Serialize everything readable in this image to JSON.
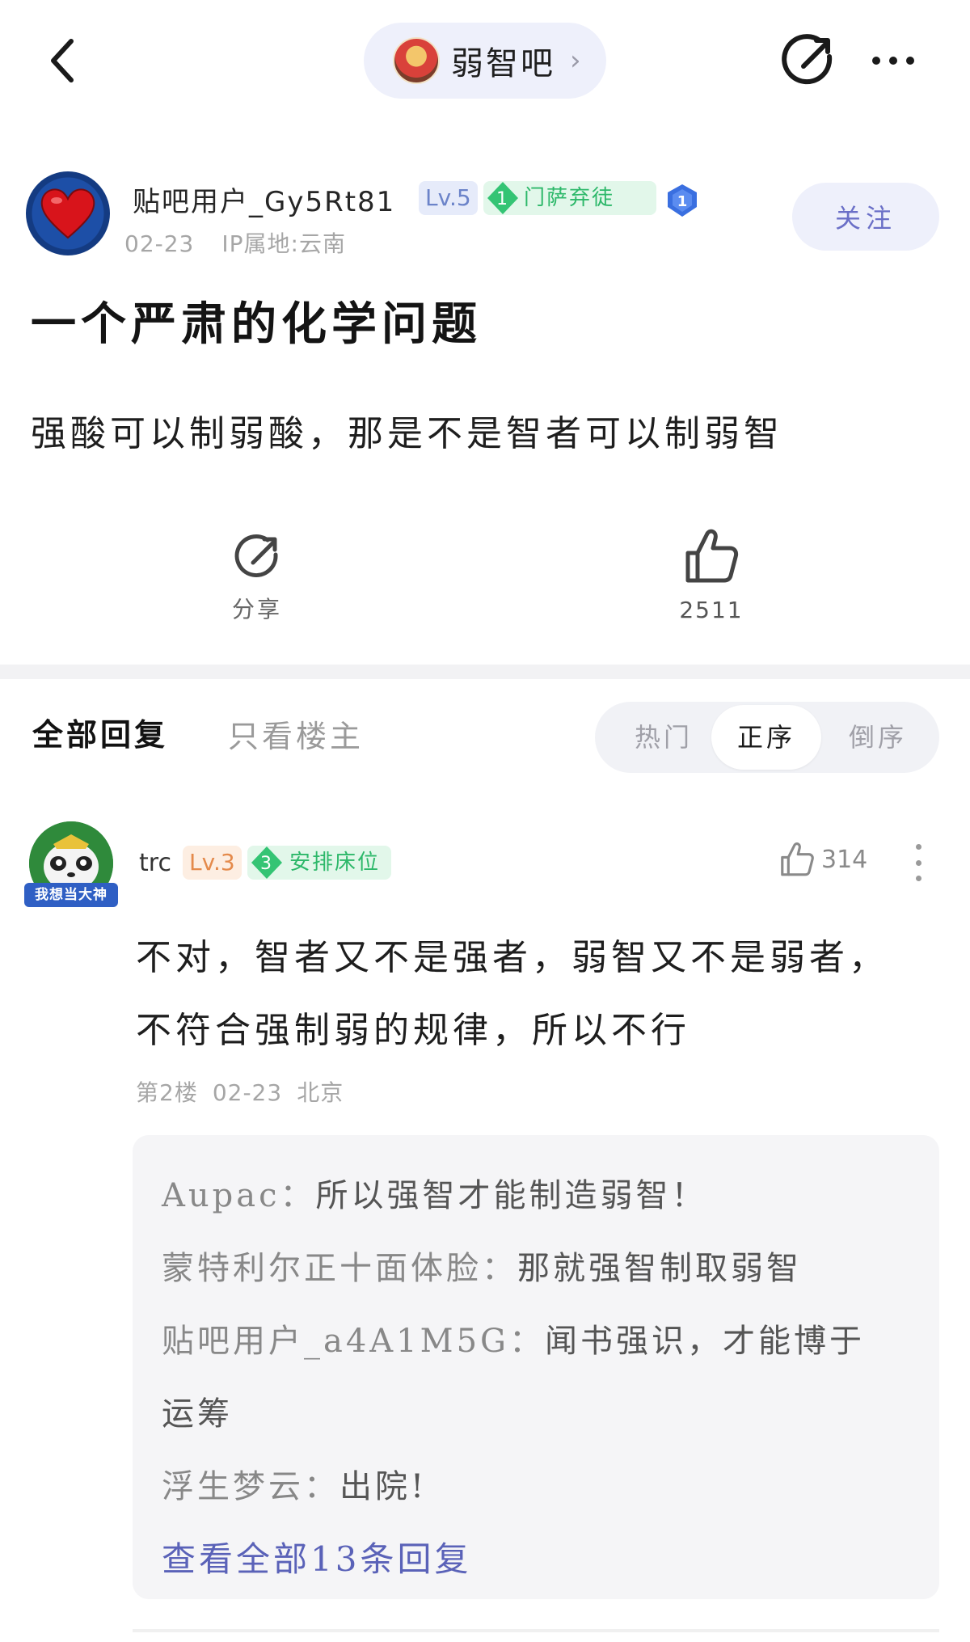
{
  "header": {
    "forum_name": "弱智吧"
  },
  "post": {
    "author": {
      "name": "贴吧用户_Gy5Rt81",
      "level": "Lv.5",
      "title_rank": "1",
      "title_name": "门萨弃徒",
      "date": "02-23",
      "ip": "IP属地:云南"
    },
    "follow_label": "关注",
    "title": "一个严肃的化学问题",
    "body": "强酸可以制弱酸，那是不是智者可以制弱智",
    "share_label": "分享",
    "like_count": "2511"
  },
  "replies_header": {
    "tab_all": "全部回复",
    "tab_owner": "只看楼主",
    "sort_hot": "热门",
    "sort_asc": "正序",
    "sort_desc": "倒序"
  },
  "reply": {
    "user": "trc",
    "level": "Lv.3",
    "title_rank": "3",
    "title_name": "安排床位",
    "avatar_banner": "我想当大神",
    "like_count": "314",
    "text_line1": "不对，智者又不是强者，弱智又不是弱者，",
    "text_line2": "不符合强制弱的规律，所以不行",
    "floor": "第2楼",
    "date": "02-23",
    "location": "北京",
    "sub_replies": [
      {
        "user": "Aupac：",
        "text": "所以强智才能制造弱智！"
      },
      {
        "user": "蒙特利尔正十面体脸：",
        "text": "那就强智制取弱智"
      },
      {
        "user": "贴吧用户_a4A1M5G：",
        "text": "闻书强识，才能博于"
      },
      {
        "user": "",
        "text": "运筹"
      },
      {
        "user": "浮生梦云：",
        "text": "出院!"
      }
    ],
    "view_all": "查看全部13条回复"
  },
  "colors": {
    "accent": "#5a62b8",
    "pill_bg": "#eef0fb",
    "badge_green": "#2db86a"
  }
}
